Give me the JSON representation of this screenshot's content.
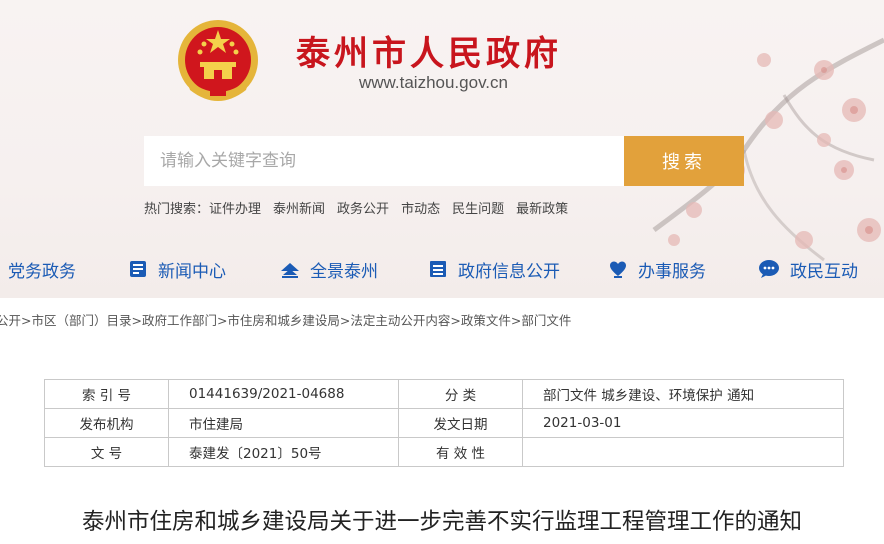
{
  "header": {
    "site_title": "泰州市人民政府",
    "site_url": "www.taizhou.gov.cn"
  },
  "search": {
    "placeholder": "请输入关键字查询",
    "button_label": "搜索"
  },
  "hot_search": {
    "label": "热门搜索：",
    "items": [
      "证件办理",
      "泰州新闻",
      "政务公开",
      "市动态",
      "民生问题",
      "最新政策"
    ]
  },
  "nav": {
    "items": [
      {
        "label": "党务政务",
        "icon": "party-icon"
      },
      {
        "label": "新闻中心",
        "icon": "news-icon"
      },
      {
        "label": "全景泰州",
        "icon": "panorama-icon"
      },
      {
        "label": "政府信息公开",
        "icon": "document-list-icon"
      },
      {
        "label": "办事服务",
        "icon": "service-heart-icon"
      },
      {
        "label": "政民互动",
        "icon": "chat-bubble-icon"
      }
    ]
  },
  "breadcrumb": "公开>市区（部门）目录>政府工作部门>市住房和城乡建设局>法定主动公开内容>政策文件>部门文件",
  "meta": {
    "row1": {
      "k1": "索 引 号",
      "v1": "01441639/2021-04688",
      "k2": "分 类",
      "v2": "部门文件 城乡建设、环境保护 通知"
    },
    "row2": {
      "k1": "发布机构",
      "v1": "市住建局",
      "k2": "发文日期",
      "v2": "2021-03-01"
    },
    "row3": {
      "k1": "文 号",
      "v1": "泰建发〔2021〕50号",
      "k2": "有 效 性",
      "v2": ""
    }
  },
  "document": {
    "title": "泰州市住房和城乡建设局关于进一步完善不实行监理工程管理工作的通知"
  },
  "colors": {
    "brand_red": "#c8151d",
    "nav_blue": "#1b5bb5",
    "search_button": "#e2a13b"
  }
}
